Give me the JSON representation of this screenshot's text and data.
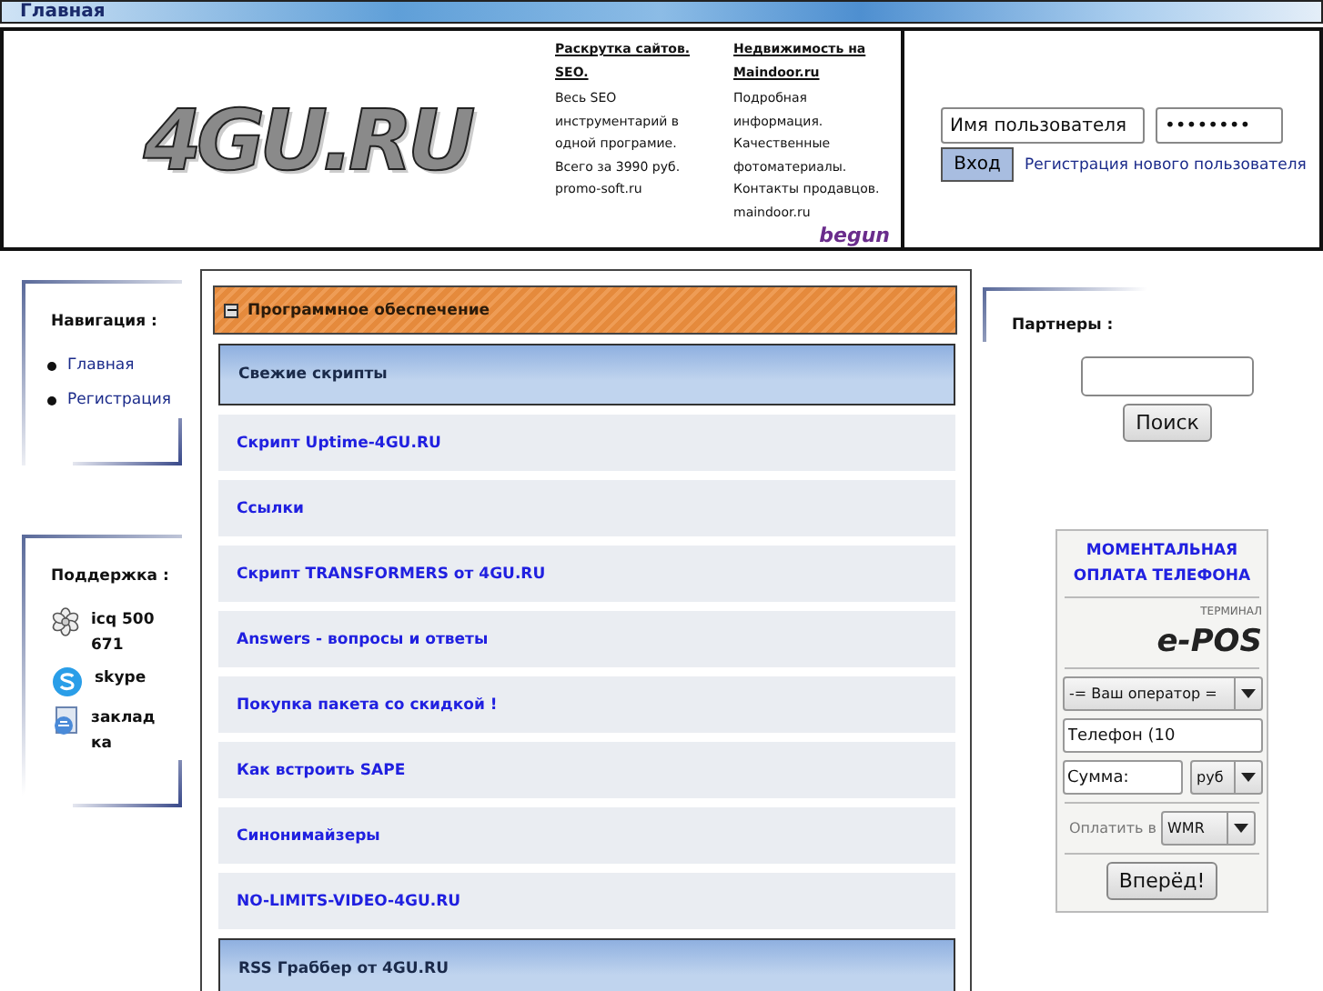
{
  "top_bar": {
    "title": "Главная"
  },
  "header": {
    "logo": "4GU.RU",
    "ads": [
      {
        "title": "Раскрутка сайтов. SEO.",
        "lines": [
          "Весь SEO инструментарий в одной програмие.",
          "Всего за 3990 руб."
        ],
        "url": "promo-soft.ru"
      },
      {
        "title": "Недвижимость на Maindoor.ru",
        "lines": [
          "Подробная информация.",
          "Качественные фотоматериалы.",
          "Контакты продавцов."
        ],
        "url": "maindoor.ru"
      }
    ],
    "ad_network": "begun",
    "login": {
      "username": "Имя пользователя",
      "password": "••••••••",
      "submit": "Вход",
      "register": "Регистрация нового пользователя"
    }
  },
  "navigation": {
    "title": "Навигация :",
    "items": [
      "Главная",
      "Регистрация"
    ]
  },
  "support": {
    "title": "Поддержка :",
    "items": [
      {
        "kind": "icq",
        "label": "icq 500671"
      },
      {
        "kind": "skype",
        "label": "skype"
      },
      {
        "kind": "bookmark",
        "label": "закладка"
      }
    ]
  },
  "content": {
    "section": {
      "title": "Программное обеспечение",
      "expanded": true
    },
    "items": [
      {
        "kind": "header",
        "label": "Свежие скрипты"
      },
      {
        "kind": "link",
        "label": "Скрипт Uptime-4GU.RU"
      },
      {
        "kind": "link",
        "label": "Ссылки"
      },
      {
        "kind": "link",
        "label": "Скрипт TRANSFORMERS от 4GU.RU"
      },
      {
        "kind": "link",
        "label": "Answers - вопросы и ответы"
      },
      {
        "kind": "link",
        "label": "Покупка пакета со скидкой !"
      },
      {
        "kind": "link",
        "label": "Как встроить SAPE"
      },
      {
        "kind": "link",
        "label": "Синонимайзеры"
      },
      {
        "kind": "link",
        "label": "NO-LIMITS-VIDEO-4GU.RU"
      },
      {
        "kind": "header",
        "label": "RSS Граббер от 4GU.RU"
      }
    ]
  },
  "partners": {
    "title": "Партнеры :",
    "search_button": "Поиск"
  },
  "payment": {
    "title": "МОМЕНТАЛЬНАЯ ОПЛАТА ТЕЛЕФОНА",
    "logo_caption": "ТЕРМИНАЛ",
    "logo": "e-POS",
    "operator": "-= Ваш оператор =",
    "phone": "Телефон (10",
    "amount": "Сумма:",
    "currency": "руб",
    "pay_in_label": "Оплатить в",
    "pay_in": "WMR",
    "submit": "Вперёд!"
  }
}
